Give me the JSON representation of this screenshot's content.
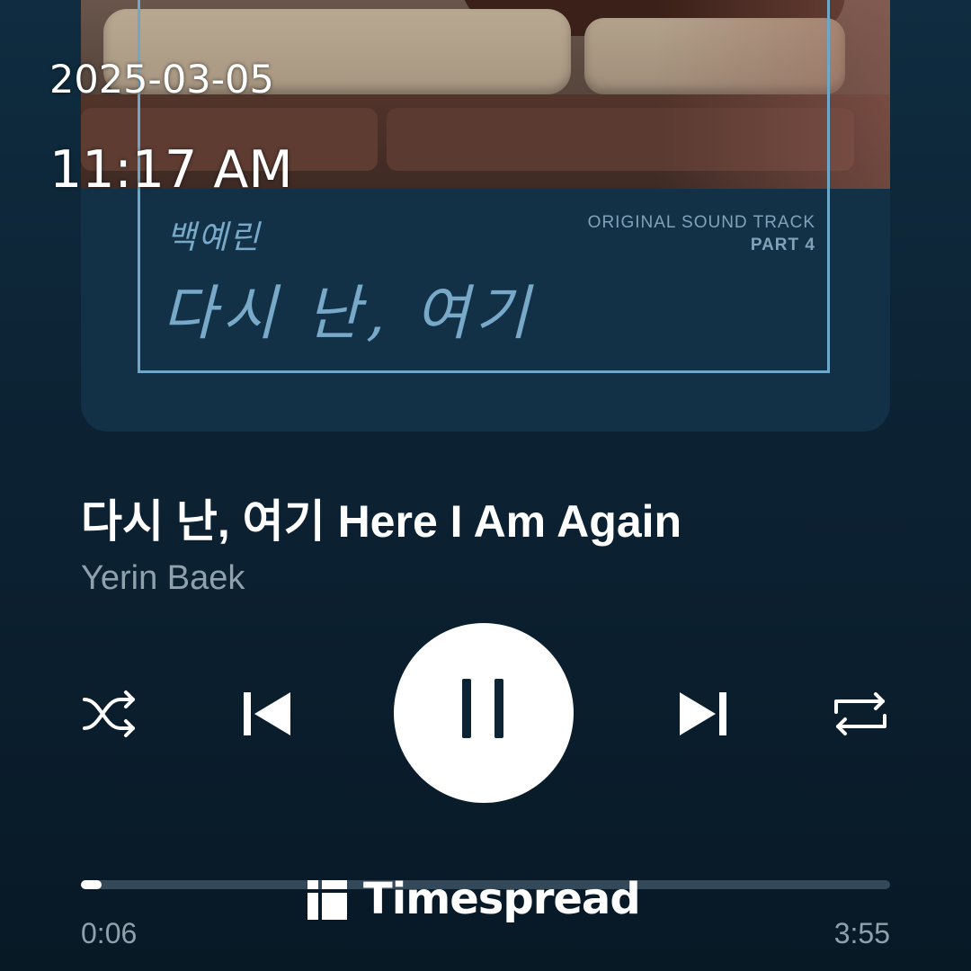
{
  "overlay": {
    "date": "2025-03-05",
    "time": "11:17 AM"
  },
  "album_art": {
    "artist_hangul": "백예린",
    "title_hangul": "다시 난, 여기",
    "ost_line": "ORIGINAL SOUND TRACK",
    "part_line": "PART 4"
  },
  "track": {
    "title": "다시 난, 여기 Here I Am Again",
    "artist": "Yerin Baek"
  },
  "controls": {
    "shuffle_icon": "shuffle-icon",
    "previous_icon": "skip-previous-icon",
    "play_state_icon": "pause-icon",
    "next_icon": "skip-next-icon",
    "repeat_icon": "repeat-icon"
  },
  "progress": {
    "elapsed": "0:06",
    "total": "3:55",
    "fraction": 0.026
  },
  "watermark": {
    "text": "Timespread"
  },
  "colors": {
    "background": "#0c2233",
    "frame_accent": "#6fa7c9",
    "text_primary": "#ffffff",
    "text_secondary": "#8ea1ad",
    "progress_track": "#33495a"
  }
}
